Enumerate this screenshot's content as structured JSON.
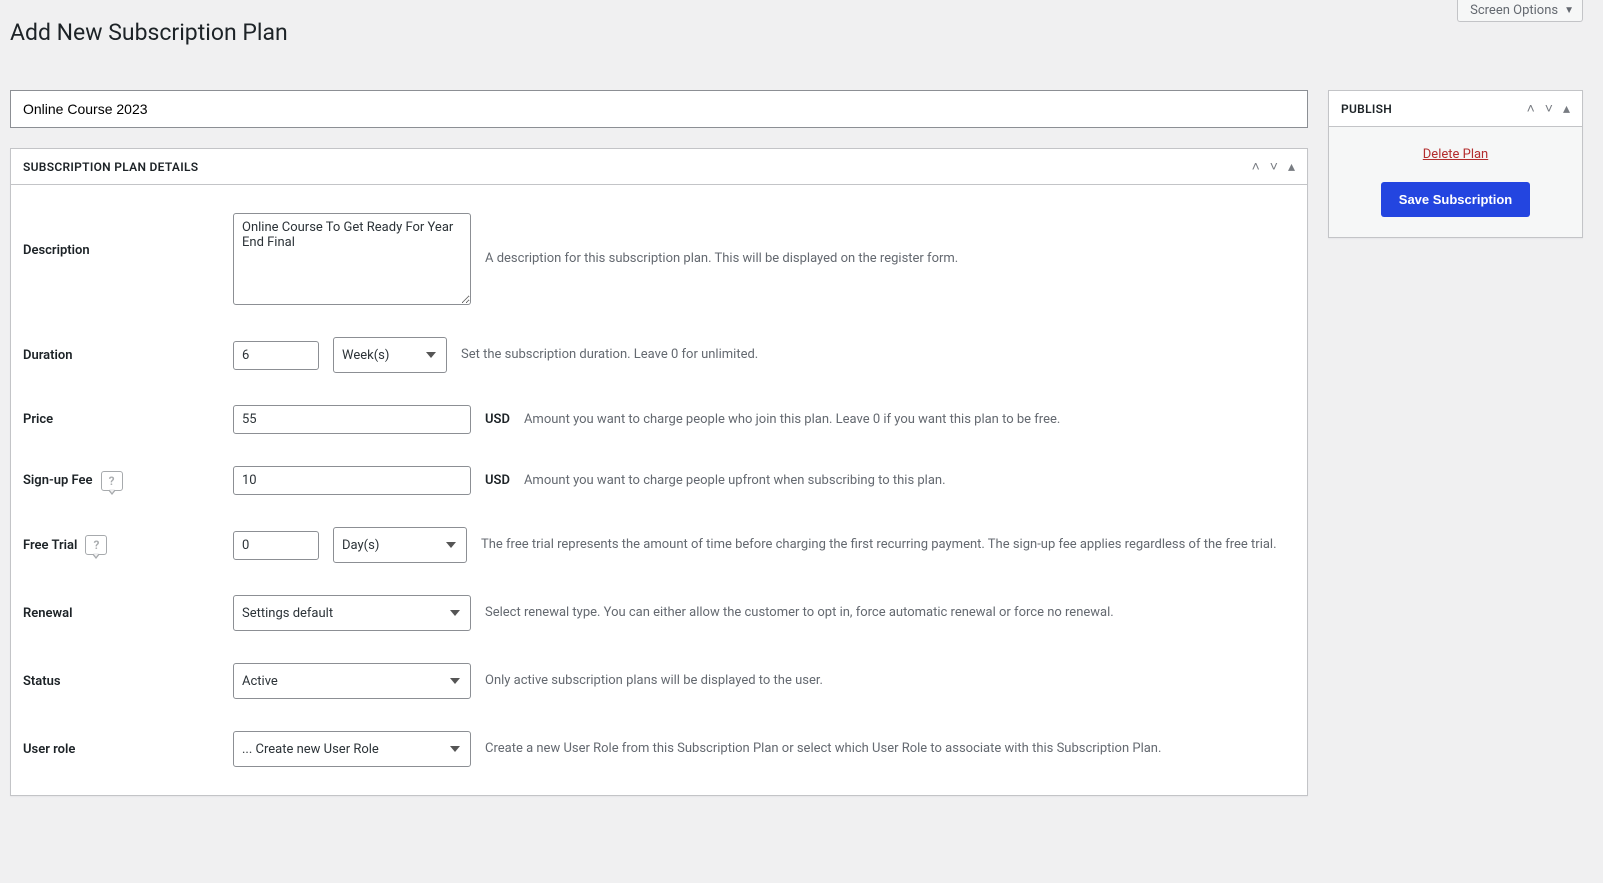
{
  "screen_options_label": "Screen Options",
  "page_title": "Add New Subscription Plan",
  "title_value": "Online Course 2023",
  "details_box_title": "SUBSCRIPTION PLAN DETAILS",
  "publish_box_title": "PUBLISH",
  "delete_link": "Delete Plan",
  "save_button": "Save Subscription",
  "currency": "USD",
  "fields": {
    "description": {
      "label": "Description",
      "value": "Online Course To Get Ready For Year End Final",
      "help": "A description for this subscription plan. This will be displayed on the register form."
    },
    "duration": {
      "label": "Duration",
      "value": "6",
      "unit": "Week(s)",
      "help": "Set the subscription duration. Leave 0 for unlimited."
    },
    "price": {
      "label": "Price",
      "value": "55",
      "help": "Amount you want to charge people who join this plan. Leave 0 if you want this plan to be free."
    },
    "signup_fee": {
      "label": "Sign-up Fee",
      "value": "10",
      "help": "Amount you want to charge people upfront when subscribing to this plan."
    },
    "free_trial": {
      "label": "Free Trial",
      "value": "0",
      "unit": "Day(s)",
      "help": "The free trial represents the amount of time before charging the first recurring payment. The sign-up fee applies regardless of the free trial."
    },
    "renewal": {
      "label": "Renewal",
      "value": "Settings default",
      "help": "Select renewal type. You can either allow the customer to opt in, force automatic renewal or force no renewal."
    },
    "status": {
      "label": "Status",
      "value": "Active",
      "help": "Only active subscription plans will be displayed to the user."
    },
    "user_role": {
      "label": "User role",
      "value": "... Create new User Role",
      "help": "Create a new User Role from this Subscription Plan or select which User Role to associate with this Subscription Plan."
    }
  }
}
